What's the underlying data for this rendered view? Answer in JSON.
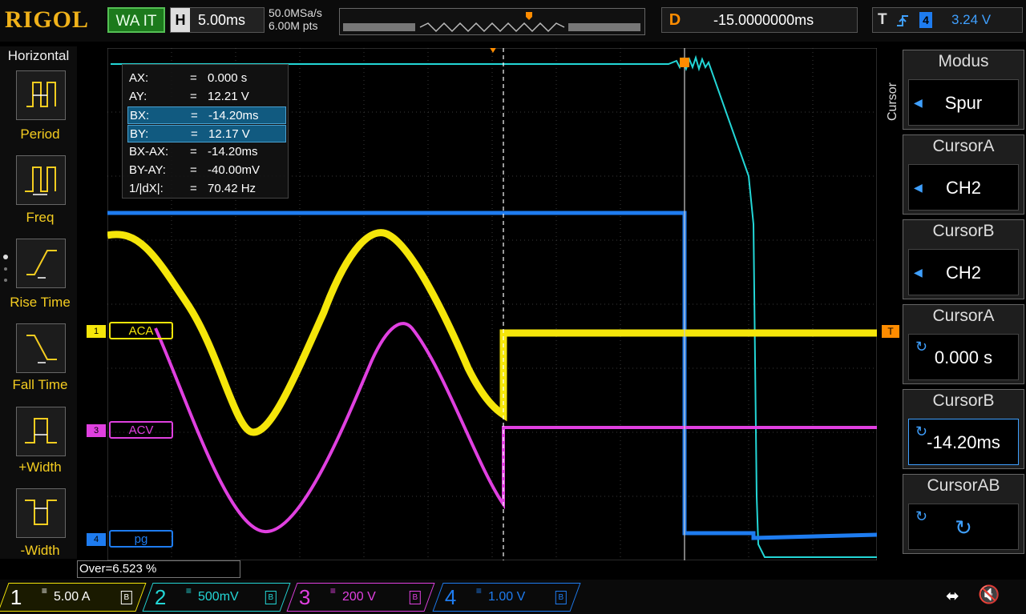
{
  "header": {
    "brand": "RIGOL",
    "run_state": "WA IT",
    "horizontal_label": "H",
    "timebase": "5.00ms",
    "sample_rate": "50.0MSa/s",
    "memory_depth": "6.00M pts",
    "delay_label": "D",
    "delay": "-15.0000000ms",
    "trigger_label": "T",
    "trigger_channel": "4",
    "trigger_level": "3.24 V"
  },
  "left_menu": {
    "title": "Horizontal",
    "items": [
      {
        "label": "Period",
        "icon": "period-icon"
      },
      {
        "label": "Freq",
        "icon": "freq-icon"
      },
      {
        "label": "Rise Time",
        "icon": "rise-time-icon"
      },
      {
        "label": "Fall Time",
        "icon": "fall-time-icon"
      },
      {
        "label": "+Width",
        "icon": "positive-width-icon"
      },
      {
        "label": "-Width",
        "icon": "negative-width-icon"
      }
    ]
  },
  "readout": {
    "rows": [
      {
        "key": "AX:",
        "value": "0.000 s",
        "highlight": false
      },
      {
        "key": "AY:",
        "value": "12.21 V",
        "highlight": false
      },
      {
        "key": "BX:",
        "value": "-14.20ms",
        "highlight": true
      },
      {
        "key": "BY:",
        "value": "12.17 V",
        "highlight": true
      },
      {
        "key": "BX-AX:",
        "value": "-14.20ms",
        "highlight": false
      },
      {
        "key": "BY-AY:",
        "value": "-40.00mV",
        "highlight": false
      },
      {
        "key": "1/|dX|:",
        "value": "70.42 Hz",
        "highlight": false
      }
    ],
    "eq": "="
  },
  "trace_labels": {
    "ch1": "ACA",
    "ch3": "ACV",
    "ch4": "pg",
    "ch1_marker": "1",
    "ch3_marker": "3",
    "ch4_marker": "4",
    "trigger_marker": "T"
  },
  "right_menu": {
    "side_title": "Cursor",
    "groups": [
      {
        "title": "Modus",
        "value": "Spur"
      },
      {
        "title": "CursorA",
        "value": "CH2"
      },
      {
        "title": "CursorB",
        "value": "CH2"
      },
      {
        "title": "CursorA",
        "value": "0.000 s"
      },
      {
        "title": "CursorB",
        "value": "-14.20ms"
      },
      {
        "title": "CursorAB",
        "value": ""
      }
    ]
  },
  "measurement": "Over=6.523 %",
  "channels": [
    {
      "num": "1",
      "scale": "5.00 A",
      "color": "#f5e60a"
    },
    {
      "num": "2",
      "scale": "500mV",
      "color": "#23d6d6"
    },
    {
      "num": "3",
      "scale": "200 V",
      "color": "#e040e0"
    },
    {
      "num": "4",
      "scale": "1.00 V",
      "color": "#1e7cf0"
    }
  ],
  "colors": {
    "ch1": "#f5e60a",
    "ch2": "#23d6d6",
    "ch3": "#e040e0",
    "ch4": "#1e7cf0",
    "trigger": "#ff8c00"
  }
}
